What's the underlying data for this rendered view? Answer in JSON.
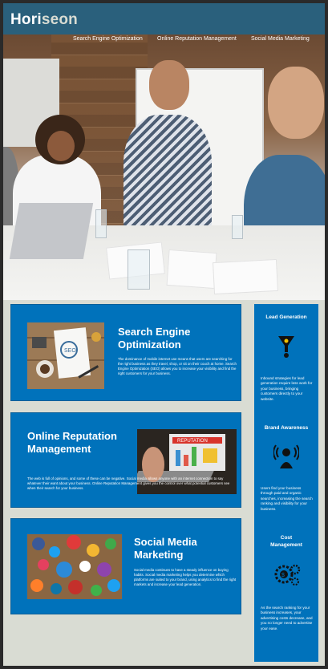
{
  "header": {
    "logo_prefix": "Hori",
    "logo_suffix": "seon",
    "nav": [
      "Search Engine Optimization",
      "Online Reputation Management",
      "Social Media Marketing"
    ]
  },
  "hero": {
    "image_icon": "business-meeting-photo"
  },
  "cards": [
    {
      "title": "Search Engine Optimization",
      "text": "The dominance of mobile internet use means that users are searching for the right business as they travel, shop, or sit on their couch at home. Search Engine Optimization (SEO) allows you to increase your visibility and find the right customers for your business.",
      "image_icon": "seo-notebook-image"
    },
    {
      "title": "Online Reputation Management",
      "text": "The web is full of opinions, and some of these can be negative. Social media allows anyone with an internet connection to say whatever their want about your business. Online Reputation Management gives you the control over what potential customers see when their search for your business.",
      "image_icon": "reputation-laptop-image"
    },
    {
      "title": "Social Media Marketing",
      "text": "Social media continues to have a steady influence on buying habits. Social media marketing helps you determine which platforms are suited to your brand, using analytics to find the right markets and increase your lead generation.",
      "image_icon": "social-media-icons-image"
    }
  ],
  "benefits": [
    {
      "title": "Lead Generation",
      "text": "Inbound strategies for lead generation require less work for your business, bringing customers directly to your website.",
      "icon": "funnel-icon"
    },
    {
      "title": "Brand Awareness",
      "text": "Users find your business through paid and organic searches, increasing the search ranking and visibility for your business.",
      "icon": "person-broadcast-icon"
    },
    {
      "title": "Cost Management",
      "text": "As the search ranking for your business increases, your advertising costs decrease, and you no longer need to advertise your ease.",
      "icon": "gears-dollar-icon"
    }
  ],
  "colors": {
    "header_bg": "#2a607c",
    "card_bg": "#0072bb",
    "page_bg": "#d9dcd3"
  }
}
